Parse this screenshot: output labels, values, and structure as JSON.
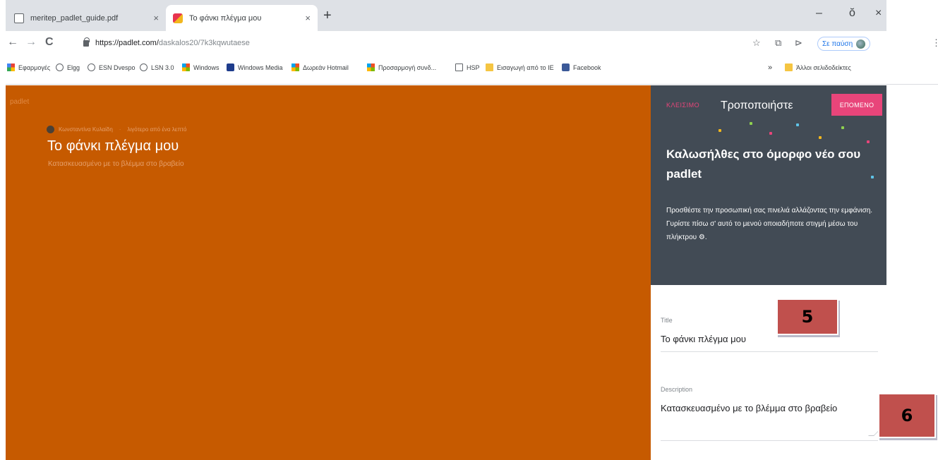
{
  "browser": {
    "tabs": [
      {
        "title": "meritep_padlet_guide.pdf",
        "active": false,
        "icon": "document-icon"
      },
      {
        "title": "Το φάνκι πλέγμα μου",
        "active": true,
        "icon": "padlet-favicon"
      }
    ],
    "tab_close": "×",
    "new_tab": "+",
    "window_controls": {
      "minimize": "–",
      "restore": "ŏ",
      "close": "×"
    },
    "nav": {
      "back": "←",
      "forward": "→",
      "reload": "C"
    },
    "url": {
      "host": "https://padlet.com/",
      "path": "daskalos20/7k3kqwutaese"
    },
    "toolbar_icons": {
      "star": "☆",
      "extension_1": "⧉",
      "extension_2": "⊳",
      "menu": "⋮"
    },
    "profile_label": "Σε παύση",
    "bookmarks": [
      {
        "label": "Εφαρμογές",
        "icon": "apps-grid-icon"
      },
      {
        "label": "Elgg",
        "icon": "globe-icon"
      },
      {
        "label": "ESN Dvespo",
        "icon": "globe-icon"
      },
      {
        "label": "LSN 3.0",
        "icon": "globe-icon"
      },
      {
        "label": "Windows",
        "icon": "windows-icon"
      },
      {
        "label": "Windows Media",
        "icon": "windows-media-icon"
      },
      {
        "label": "Δωρεάν Hotmail",
        "icon": "windows-icon"
      },
      {
        "label": "Προσαρμογή συνδ...",
        "icon": "windows-icon"
      },
      {
        "label": "HSP",
        "icon": "page-icon"
      },
      {
        "label": "Εισαγωγή από το IE",
        "icon": "folder-icon"
      },
      {
        "label": "Facebook",
        "icon": "facebook-icon"
      }
    ],
    "bookmarks_overflow": "»",
    "other_bookmarks": "Άλλοι σελιδοδείκτες"
  },
  "padlet": {
    "logo": "padlet",
    "author": "Κωνσταντίνα Κυλαίδη",
    "breadcrumb_separator": "·",
    "timestamp": "λιγότερο από ένα λεπτό",
    "title": "Το φάνκι πλέγμα μου",
    "subtitle": "Κατασκευασμένο με το βλέμμα στο βραβείο",
    "background_color": "#c65a00"
  },
  "panel": {
    "close_label": "ΚΛΕΙΣΙΜΟ",
    "heading": "Τροποποιήστε",
    "next_label": "ΕΠΟΜΕΝΟ",
    "welcome_title": "Καλωσήλθες στο όμορφο νέο σου padlet",
    "welcome_body": "Προσθέστε την προσωπική σας πινελιά αλλάζοντας την εμφάνιση. Γυρίστε πίσω σ' αυτό το μενού οποιαδήποτε στιγμή μέσω του πλήκτρου ⚙.",
    "title_field": {
      "label": "Title",
      "value": "Το φάνκι πλέγμα μου"
    },
    "description_field": {
      "label": "Description",
      "value": "Κατασκευασμένο με το βλέμμα στο βραβείο"
    },
    "accent_color": "#e8457a",
    "header_color": "#424b55"
  },
  "annotations": [
    {
      "label": "5"
    },
    {
      "label": "6"
    }
  ]
}
